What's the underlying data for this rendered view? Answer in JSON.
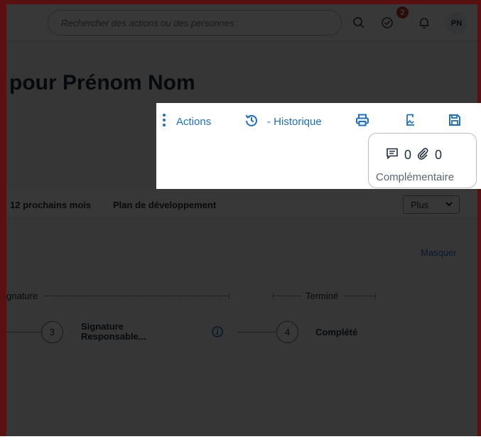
{
  "topbar": {
    "search_placeholder": "Rechercher des actions ou des personnes",
    "tasks_badge": "2",
    "avatar_initials": "PN"
  },
  "page": {
    "title": "pour Prénom Nom"
  },
  "toolbar": {
    "actions_label": "Actions",
    "history_label": "- Historique",
    "comments_count": "0",
    "attachments_count": "0",
    "counters_label": "Complémentaire"
  },
  "tabs": {
    "items": [
      "12 prochains mois",
      "Plan de développement"
    ],
    "more_select": "Plus"
  },
  "workflow": {
    "hide_link": "Masquer",
    "phases": [
      "gnature",
      "Terminé"
    ],
    "steps": [
      {
        "number": "3",
        "label_line1": "Signature",
        "label_line2": "Responsable..."
      },
      {
        "number": "4",
        "label_line1": "Complété"
      }
    ]
  },
  "colors": {
    "accent": "#1d6fc4",
    "badge": "#c0392b",
    "text": "#1f2d3d"
  }
}
